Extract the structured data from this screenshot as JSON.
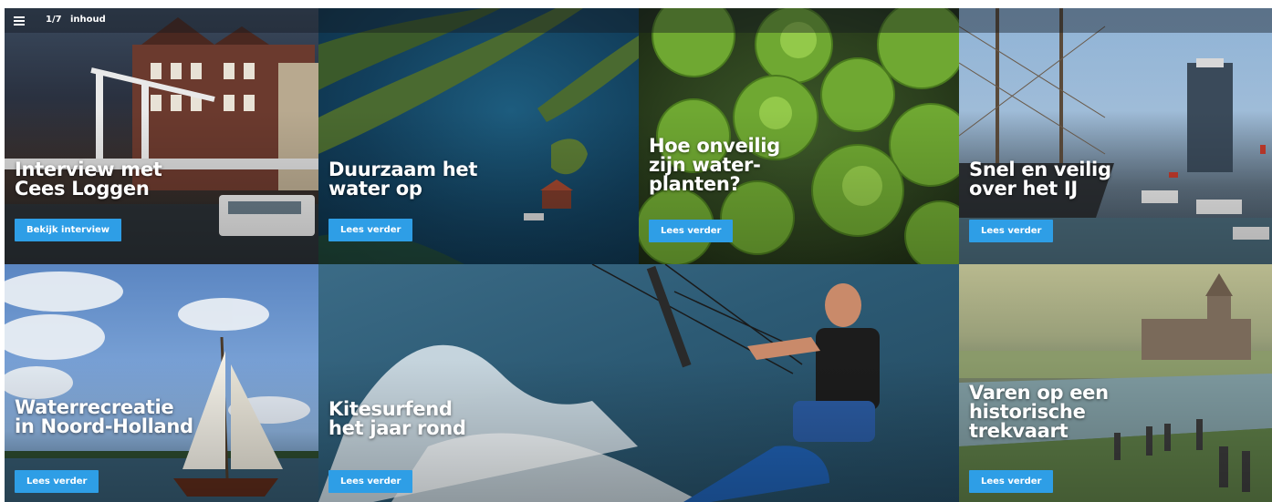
{
  "topbar": {
    "counter": "1/7",
    "inhoud_label": "inhoud",
    "menu_icon": "hamburger-icon"
  },
  "tiles": [
    {
      "title": "Interview met\nCees Loggen",
      "button": "Bekijk interview",
      "image": "drawbridge-canal-houses"
    },
    {
      "title": "Duurzaam het\nwater op",
      "button": "Lees verder",
      "image": "aerial-lake-islands"
    },
    {
      "title": "Hoe onveilig\nzijn water-\nplanten?",
      "button": "Lees verder",
      "image": "lily-pads"
    },
    {
      "title": "Snel en veilig\nover het IJ",
      "button": "Lees verder",
      "image": "tall-ship-harbor"
    },
    {
      "title": "Waterrecreatie\nin Noord-Holland",
      "button": "Lees verder",
      "image": "sailboat"
    },
    {
      "title": "Kitesurfend\nhet jaar rond",
      "button": "Lees verder",
      "image": "kitesurfer"
    },
    {
      "title": "Varen op een\nhistorische\ntrekvaart",
      "button": "Lees verder",
      "image": "historic-canal-postcard"
    }
  ],
  "colors": {
    "button_bg": "#2e9ee6",
    "title_text": "#ffffff"
  }
}
